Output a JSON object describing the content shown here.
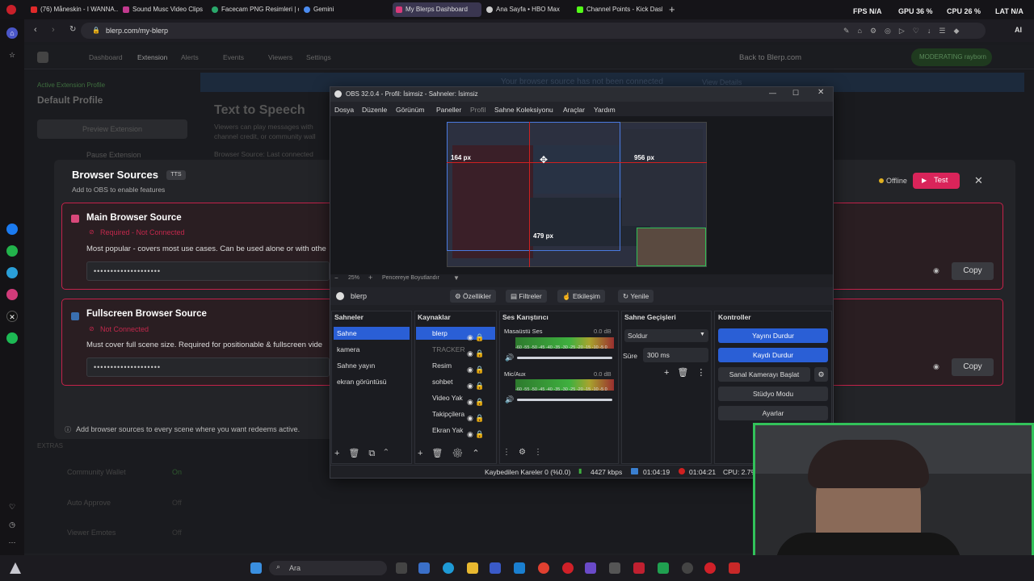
{
  "browser": {
    "tabs": [
      {
        "label": "(76) Måneskin - I WANNA...",
        "color": "#e02a2a"
      },
      {
        "label": "Sound Musc Video Clips",
        "color": "#c23a8f"
      },
      {
        "label": "Facecam PNG Resimleri | c",
        "color": "#2aa86b"
      },
      {
        "label": "Gemini",
        "color": "#4b8cf0"
      },
      {
        "label": "My Blerps Dashboard",
        "color": "#d93a7a"
      },
      {
        "label": "Ana Sayfa • HBO Max",
        "color": "#cccccc"
      },
      {
        "label": "Channel Points - Kick Dash",
        "color": "#53fc18"
      }
    ],
    "url": "blerp.com/my-blerp",
    "stats": {
      "fps_label": "FPS",
      "fps": "N/A",
      "gpu_label": "GPU",
      "gpu": "36 %",
      "cpu_label": "CPU",
      "cpu": "26 %",
      "lat_label": "LAT",
      "lat": "N/A"
    },
    "ai_label": "AI"
  },
  "dashboard": {
    "nav": [
      "Dashboard",
      "Extension",
      "Alerts",
      "Events",
      "Viewers",
      "Settings"
    ],
    "back_link": "Back to Blerp.com",
    "moderating": "MODERATING",
    "username": "rayborn",
    "connection_banner": "Your browser source has not been connected",
    "view_details": "View Details",
    "active_profile_label": "Active Extension Profile",
    "profile_name": "Default Profile",
    "preview_btn": "Preview Extension",
    "pause_btn": "Pause Extension",
    "tts_title": "Text to Speech",
    "tts_desc": "Viewers can play messages with",
    "tts_desc2": "channel credit, or community wall",
    "browser_source_status": "Browser Source:",
    "browser_source_value": "Last connected",
    "extras": "EXTRAS",
    "extras_items": [
      {
        "label": "Community Wallet",
        "value": "On"
      },
      {
        "label": "Auto Approve",
        "value": "Off"
      },
      {
        "label": "Viewer Emotes",
        "value": "Off"
      }
    ]
  },
  "modal": {
    "title": "Browser Sources",
    "badge": "TTS",
    "subtitle": "Add to OBS to enable features",
    "status": "Offline",
    "test_btn": "Test",
    "sources": [
      {
        "name": "Main Browser Source",
        "status": "Required - Not Connected",
        "desc": "Most popular - covers most use cases. Can be used alone or with othe",
        "key": "••••••••••••••••••••",
        "copy": "Copy"
      },
      {
        "name": "Fullscreen Browser Source",
        "status": "Not Connected",
        "desc": "Must cover full scene size. Required for positionable & fullscreen vide",
        "key": "••••••••••••••••••••",
        "copy": "Copy"
      }
    ],
    "footer_note": "Add browser sources to every scene where you want redeems active."
  },
  "obs": {
    "title": "OBS 32.0.4 - Profil: İsimsiz - Sahneler: İsimsiz",
    "menu": [
      "Dosya",
      "Düzenle",
      "Görünüm",
      "Paneller",
      "Profil",
      "Sahne Koleksiyonu",
      "Araçlar",
      "Yardım"
    ],
    "preview_labels": {
      "left": "164 px",
      "right": "956 px",
      "bottom": "479 px"
    },
    "zoom": "25%",
    "fit_label": "Pencereye Boyutlandır",
    "selected_source": "blerp",
    "toolbar": [
      "Özellikler",
      "Filtreler",
      "Etkileşim",
      "Yenile"
    ],
    "docks": {
      "scenes": "Sahneler",
      "sources": "Kaynaklar",
      "mixer": "Ses Karıştırıcı",
      "transitions": "Sahne Geçişleri",
      "controls": "Kontroller"
    },
    "scenes": [
      "Sahne",
      "kamera",
      "Sahne yayın",
      "ekran görüntüsü"
    ],
    "sources": [
      "blerp",
      "TRACKER",
      "Resim",
      "sohbet",
      "Video Yak",
      "Takipçilera",
      "Ekran Yak"
    ],
    "mixer": [
      {
        "name": "Masaüstü Ses",
        "db": "0.0 dB"
      },
      {
        "name": "Mic/Aux",
        "db": "0.0 dB"
      }
    ],
    "meter_scale": "-60 -55 -50 -45 -40 -35 -30 -25 -20 -15 -10 -5 0",
    "transition": "Soldur",
    "duration_label": "Süre",
    "duration": "300 ms",
    "controls": [
      "Yayını Durdur",
      "Kaydı Durdur",
      "Sanal Kamerayı Başlat",
      "Stüdyo Modu",
      "Ayarlar"
    ],
    "status": {
      "dropped": "Kaybedilen Kareler 0 (%0.0)",
      "bitrate": "4427 kbps",
      "stream_time": "01:04:19",
      "rec_time": "01:04:21",
      "cpu": "CPU: 2.7%"
    }
  },
  "taskbar": {
    "search": "Ara"
  }
}
